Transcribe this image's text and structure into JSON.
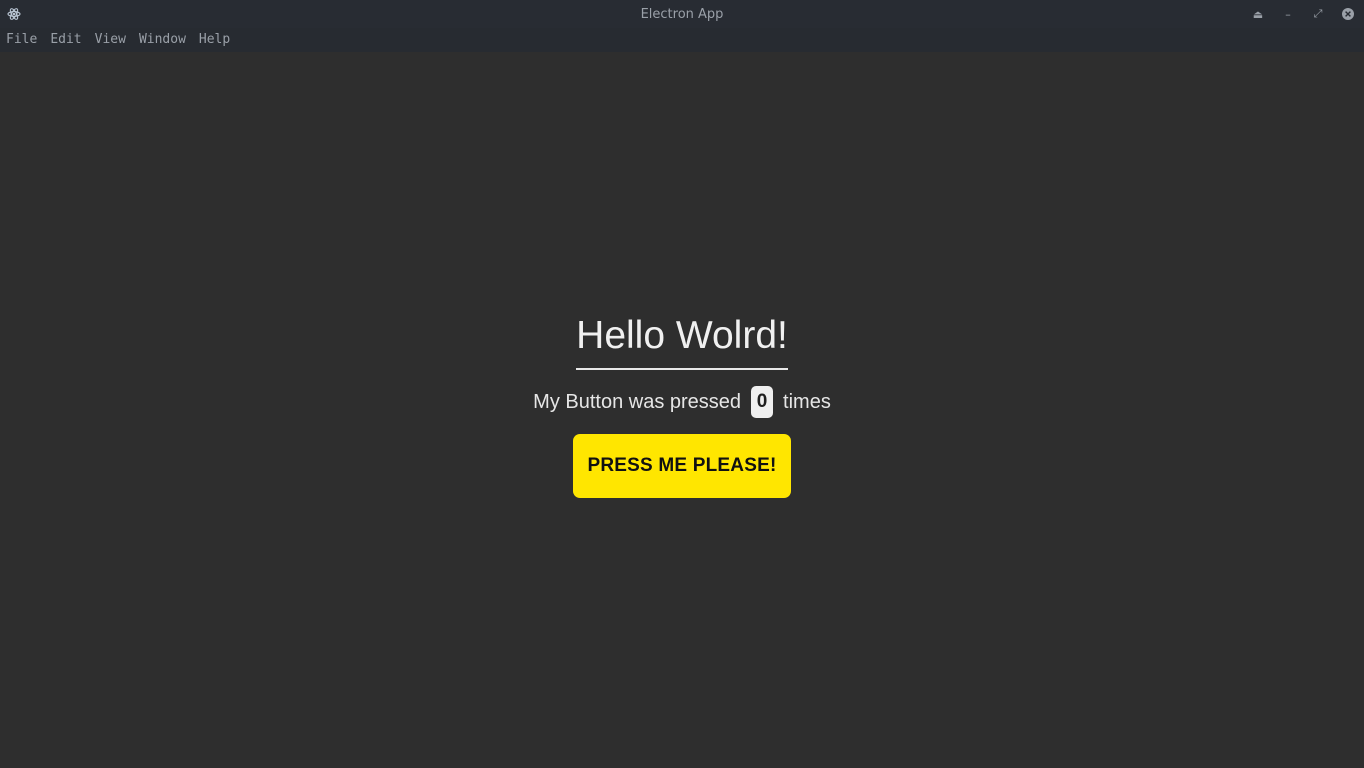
{
  "window": {
    "title": "Electron App",
    "app_icon": "electron-icon",
    "controls": [
      {
        "name": "eject-icon",
        "glyph": "⏏"
      },
      {
        "name": "minimize-icon",
        "glyph": "–"
      },
      {
        "name": "maximize-icon",
        "glyph": "⤢"
      },
      {
        "name": "close-icon",
        "glyph": "✕"
      }
    ]
  },
  "menu": {
    "items": [
      "File",
      "Edit",
      "View",
      "Window",
      "Help"
    ]
  },
  "main": {
    "heading": "Hello Wolrd!",
    "press_prefix": "My Button was pressed",
    "press_count": "0",
    "press_suffix": "times",
    "button_label": "PRESS ME PLEASE!"
  },
  "colors": {
    "button_bg": "#ffe600",
    "background": "#2e2e2e"
  }
}
